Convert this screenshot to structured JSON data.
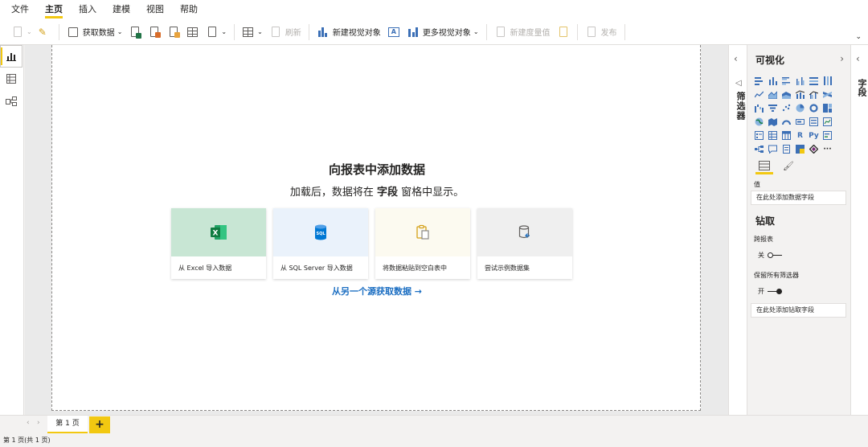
{
  "menu": {
    "tabs": [
      {
        "label": "文件"
      },
      {
        "label": "主页"
      },
      {
        "label": "插入"
      },
      {
        "label": "建模"
      },
      {
        "label": "视图"
      },
      {
        "label": "帮助"
      }
    ],
    "active_tab": "主页"
  },
  "ribbon": {
    "get_data": "获取数据",
    "refresh": "刷新",
    "new_visual": "新建视觉对象",
    "more_visuals": "更多视觉对象",
    "new_measure": "新建度量值",
    "publish": "发布"
  },
  "canvas": {
    "title": "向报表中添加数据",
    "subtitle_pre": "加载后，数据将在",
    "subtitle_bold": "字段",
    "subtitle_post": "窗格中显示。",
    "cards": [
      {
        "label": "从 Excel 导入数据",
        "icon": "excel-icon",
        "color": "#c8e6d4"
      },
      {
        "label": "从 SQL Server 导入数据",
        "icon": "sql-server-icon",
        "color": "#eaf2fb"
      },
      {
        "label": "将数据粘贴到空白表中",
        "icon": "paste-icon",
        "color": "#fcfaf0"
      },
      {
        "label": "尝试示例数据集",
        "icon": "sample-dataset-icon",
        "color": "#efefef"
      }
    ],
    "other_source_link": "从另一个源获取数据 →"
  },
  "filters": {
    "label": "筛选器"
  },
  "visualizations": {
    "title": "可视化",
    "values_label": "值",
    "values_placeholder": "在此处添加数据字段",
    "drillthrough_title": "钻取",
    "cross_report_label": "跨报表",
    "cross_report_state": "关",
    "keep_filters_label": "保留所有筛选器",
    "keep_filters_state": "开",
    "drill_placeholder": "在此处添加钻取字段"
  },
  "fields": {
    "label": "字段"
  },
  "pages": {
    "tab_label": "第 1 页",
    "add_label": "+"
  },
  "status": {
    "text": "第 1 页(共 1 页)"
  },
  "colors": {
    "accent": "#f2c811",
    "link": "#1b6ec2",
    "excel": "#217346",
    "sql": "#0078d4"
  }
}
